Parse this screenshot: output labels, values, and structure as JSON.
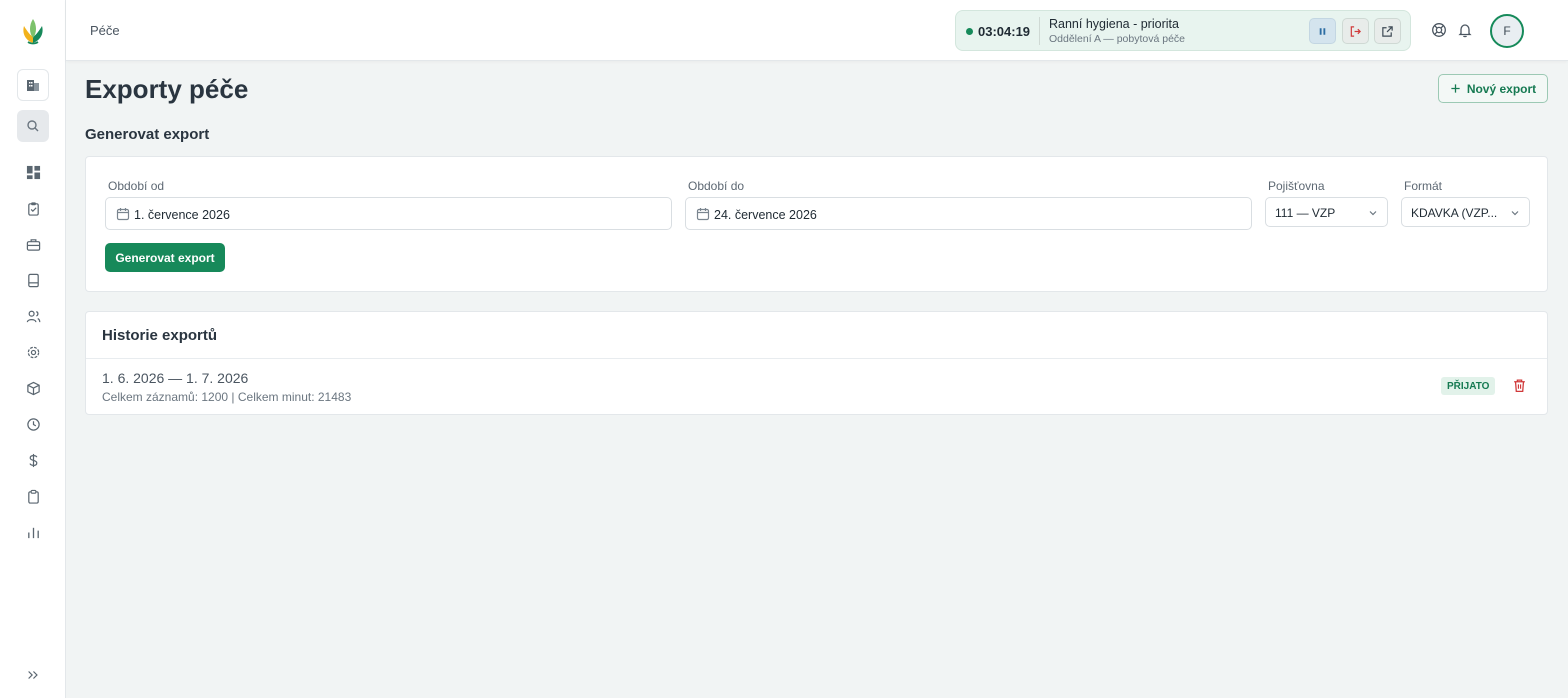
{
  "topbar": {
    "breadcrumb": "Péče",
    "timer": {
      "time": "03:04:19",
      "task_title": "Ranní hygiena - priorita",
      "task_subtitle": "Oddělení A — pobytová péče"
    },
    "avatar_initial": "F"
  },
  "page": {
    "title": "Exporty péče",
    "new_export_label": "Nový export"
  },
  "generate": {
    "section_title": "Generovat export",
    "period_from_label": "Období od",
    "period_from_value": "1. července 2026",
    "period_to_label": "Období do",
    "period_to_value": "24. července 2026",
    "insurer_label": "Pojišťovna",
    "insurer_value": "111 — VZP",
    "format_label": "Formát",
    "format_value": "KDAVKA (VZP...",
    "button_label": "Generovat export"
  },
  "history": {
    "title": "Historie exportů",
    "rows": [
      {
        "range": "1. 6. 2026 — 1. 7. 2026",
        "meta": "Celkem záznamů: 1200 | Celkem minut: 21483",
        "status": "PŘIJATO"
      }
    ]
  },
  "colors": {
    "brand": "#17895a",
    "timer_bg": "#e8f4ef",
    "badge_bg": "#e2f2ea",
    "danger": "#d0393a"
  },
  "sidebar": {
    "icons": [
      "building-icon",
      "search-icon",
      "dashboard-icon",
      "clipboard-check-icon",
      "briefcase-icon",
      "book-icon",
      "users-icon",
      "settings-icon",
      "package-icon",
      "clock-icon",
      "dollar-icon",
      "clipboard-icon",
      "bar-chart-icon",
      "chevrons-right-icon"
    ]
  }
}
